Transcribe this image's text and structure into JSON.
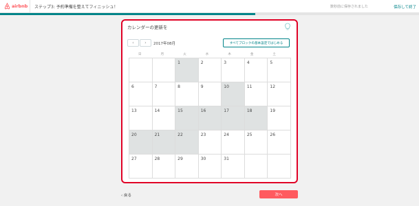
{
  "header": {
    "logo_text": "airbnb",
    "step_title": "ステップ3: 予約準備を整えてフィニッシュ！",
    "saved_status": "数秒前に保存されました",
    "save_exit": "保存して終了",
    "progress_percent": 61,
    "brand_color": "#ff5a5f",
    "accent_color": "#008489"
  },
  "card": {
    "title": "カレンダーの更新を",
    "hint_icon": "lightbulb-icon",
    "prev_icon": "‹",
    "next_icon": "›",
    "month_label": "2017年08月",
    "blocked_button": "すべてブロックの基本設定ではじめる"
  },
  "calendar": {
    "weekdays": [
      "日",
      "月",
      "火",
      "水",
      "木",
      "金",
      "土"
    ],
    "cells": [
      {
        "day": "",
        "blocked": false
      },
      {
        "day": "",
        "blocked": false
      },
      {
        "day": "1",
        "blocked": true
      },
      {
        "day": "2",
        "blocked": false
      },
      {
        "day": "3",
        "blocked": false
      },
      {
        "day": "4",
        "blocked": false
      },
      {
        "day": "5",
        "blocked": false
      },
      {
        "day": "6",
        "blocked": false
      },
      {
        "day": "7",
        "blocked": false
      },
      {
        "day": "8",
        "blocked": false
      },
      {
        "day": "9",
        "blocked": false
      },
      {
        "day": "10",
        "blocked": true
      },
      {
        "day": "11",
        "blocked": false
      },
      {
        "day": "12",
        "blocked": false
      },
      {
        "day": "13",
        "blocked": false
      },
      {
        "day": "14",
        "blocked": false
      },
      {
        "day": "15",
        "blocked": true
      },
      {
        "day": "16",
        "blocked": true
      },
      {
        "day": "17",
        "blocked": true
      },
      {
        "day": "18",
        "blocked": true
      },
      {
        "day": "19",
        "blocked": false
      },
      {
        "day": "20",
        "blocked": true
      },
      {
        "day": "21",
        "blocked": true
      },
      {
        "day": "22",
        "blocked": true
      },
      {
        "day": "23",
        "blocked": false
      },
      {
        "day": "24",
        "blocked": false
      },
      {
        "day": "25",
        "blocked": false
      },
      {
        "day": "26",
        "blocked": false
      },
      {
        "day": "27",
        "blocked": false
      },
      {
        "day": "28",
        "blocked": false
      },
      {
        "day": "29",
        "blocked": false
      },
      {
        "day": "30",
        "blocked": false
      },
      {
        "day": "31",
        "blocked": false
      },
      {
        "day": "",
        "blocked": false
      },
      {
        "day": "",
        "blocked": false
      }
    ]
  },
  "footer": {
    "back_label": "‹ 戻る",
    "next_label": "次へ"
  }
}
